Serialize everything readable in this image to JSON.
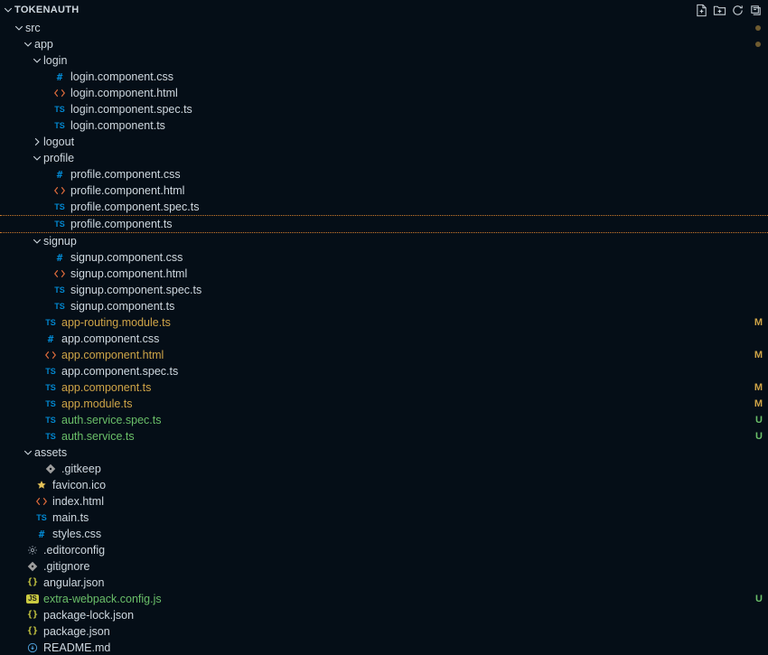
{
  "header": {
    "title": "TOKENAUTH",
    "actions": [
      "new-file",
      "new-folder",
      "refresh",
      "collapse-all"
    ]
  },
  "dots": {
    "on_src": "#6f5b30",
    "on_app": "#6f5b30"
  },
  "tree": [
    {
      "depth": 0,
      "kind": "folder",
      "name": "src",
      "open": true,
      "dot": "on_src"
    },
    {
      "depth": 1,
      "kind": "folder",
      "name": "app",
      "open": true,
      "dot": "on_app"
    },
    {
      "depth": 2,
      "kind": "folder",
      "name": "login",
      "open": true
    },
    {
      "depth": 3,
      "kind": "file",
      "name": "login.component.css",
      "ext": "css"
    },
    {
      "depth": 3,
      "kind": "file",
      "name": "login.component.html",
      "ext": "html"
    },
    {
      "depth": 3,
      "kind": "file",
      "name": "login.component.spec.ts",
      "ext": "ts"
    },
    {
      "depth": 3,
      "kind": "file",
      "name": "login.component.ts",
      "ext": "ts"
    },
    {
      "depth": 2,
      "kind": "folder",
      "name": "logout",
      "open": false
    },
    {
      "depth": 2,
      "kind": "folder",
      "name": "profile",
      "open": true
    },
    {
      "depth": 3,
      "kind": "file",
      "name": "profile.component.css",
      "ext": "css"
    },
    {
      "depth": 3,
      "kind": "file",
      "name": "profile.component.html",
      "ext": "html"
    },
    {
      "depth": 3,
      "kind": "file",
      "name": "profile.component.spec.ts",
      "ext": "ts"
    },
    {
      "depth": 3,
      "kind": "file",
      "name": "profile.component.ts",
      "ext": "ts",
      "dropTarget": true
    },
    {
      "depth": 2,
      "kind": "folder",
      "name": "signup",
      "open": true
    },
    {
      "depth": 3,
      "kind": "file",
      "name": "signup.component.css",
      "ext": "css"
    },
    {
      "depth": 3,
      "kind": "file",
      "name": "signup.component.html",
      "ext": "html"
    },
    {
      "depth": 3,
      "kind": "file",
      "name": "signup.component.spec.ts",
      "ext": "ts"
    },
    {
      "depth": 3,
      "kind": "file",
      "name": "signup.component.ts",
      "ext": "ts"
    },
    {
      "depth": 2,
      "kind": "file",
      "name": "app-routing.module.ts",
      "ext": "ts",
      "color": "amber",
      "status": "M",
      "statusColor": "amber"
    },
    {
      "depth": 2,
      "kind": "file",
      "name": "app.component.css",
      "ext": "css"
    },
    {
      "depth": 2,
      "kind": "file",
      "name": "app.component.html",
      "ext": "html",
      "color": "amber",
      "status": "M",
      "statusColor": "amber"
    },
    {
      "depth": 2,
      "kind": "file",
      "name": "app.component.spec.ts",
      "ext": "ts"
    },
    {
      "depth": 2,
      "kind": "file",
      "name": "app.component.ts",
      "ext": "ts",
      "color": "amber",
      "status": "M",
      "statusColor": "amber"
    },
    {
      "depth": 2,
      "kind": "file",
      "name": "app.module.ts",
      "ext": "ts",
      "color": "amber",
      "status": "M",
      "statusColor": "amber"
    },
    {
      "depth": 2,
      "kind": "file",
      "name": "auth.service.spec.ts",
      "ext": "ts",
      "color": "green",
      "status": "U",
      "statusColor": "green"
    },
    {
      "depth": 2,
      "kind": "file",
      "name": "auth.service.ts",
      "ext": "ts",
      "color": "green",
      "status": "U",
      "statusColor": "green"
    },
    {
      "depth": 1,
      "kind": "folder",
      "name": "assets",
      "open": true
    },
    {
      "depth": 2,
      "kind": "file",
      "name": ".gitkeep",
      "ext": "gitkeep"
    },
    {
      "depth": 1,
      "kind": "file",
      "name": "favicon.ico",
      "ext": "ico"
    },
    {
      "depth": 1,
      "kind": "file",
      "name": "index.html",
      "ext": "html"
    },
    {
      "depth": 1,
      "kind": "file",
      "name": "main.ts",
      "ext": "ts"
    },
    {
      "depth": 1,
      "kind": "file",
      "name": "styles.css",
      "ext": "css"
    },
    {
      "depth": 0,
      "kind": "file",
      "name": ".editorconfig",
      "ext": "config"
    },
    {
      "depth": 0,
      "kind": "file",
      "name": ".gitignore",
      "ext": "gitkeep"
    },
    {
      "depth": 0,
      "kind": "file",
      "name": "angular.json",
      "ext": "json"
    },
    {
      "depth": 0,
      "kind": "file",
      "name": "extra-webpack.config.js",
      "ext": "js",
      "color": "green",
      "status": "U",
      "statusColor": "green"
    },
    {
      "depth": 0,
      "kind": "file",
      "name": "package-lock.json",
      "ext": "json"
    },
    {
      "depth": 0,
      "kind": "file",
      "name": "package.json",
      "ext": "json"
    },
    {
      "depth": 0,
      "kind": "file",
      "name": "README.md",
      "ext": "md"
    }
  ]
}
